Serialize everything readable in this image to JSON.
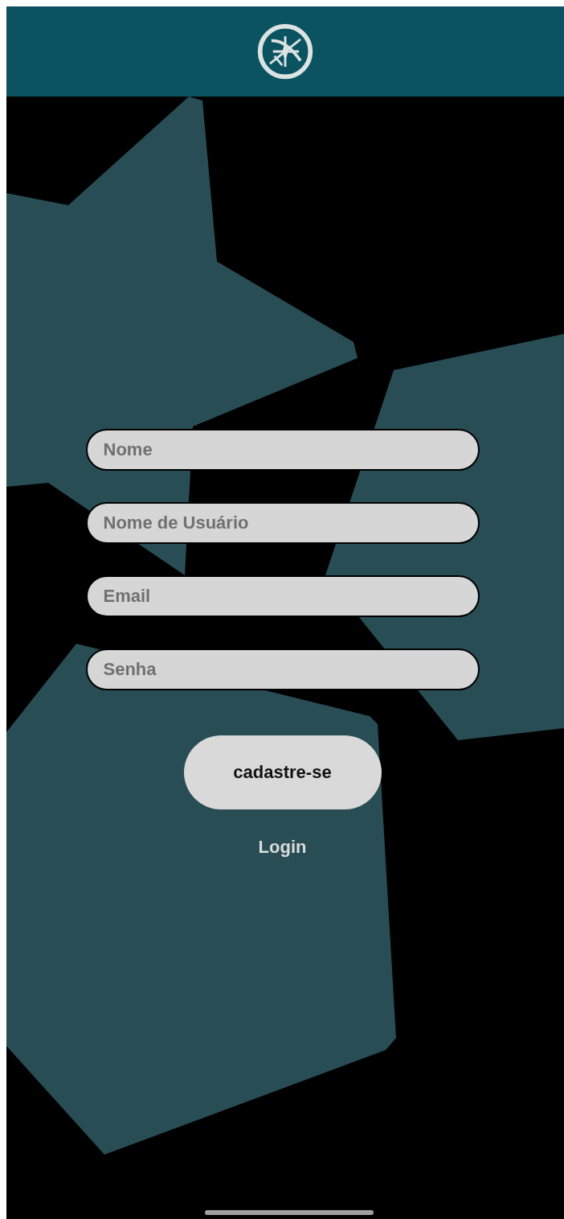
{
  "fields": [
    {
      "placeholder": "Nome"
    },
    {
      "placeholder": "Nome de Usuário"
    },
    {
      "placeholder": "Email"
    },
    {
      "placeholder": "Senha"
    }
  ],
  "signup_button": {
    "label": "cadastre-se"
  },
  "login_link": {
    "label": "Login"
  }
}
